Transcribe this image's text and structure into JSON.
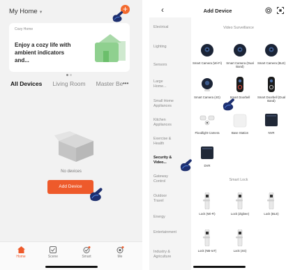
{
  "left": {
    "home_title": "My Home",
    "banner": {
      "tag": "Cozy Home",
      "text": "Enjoy a cozy life with ambient indicators and..."
    },
    "tabs": [
      "All Devices",
      "Living Room",
      "Master Be"
    ],
    "empty_text": "No devices",
    "add_device_label": "Add Device",
    "nav": [
      {
        "label": "Home",
        "icon": "home-icon",
        "active": true
      },
      {
        "label": "Scene",
        "icon": "scene-icon",
        "active": false
      },
      {
        "label": "Smart",
        "icon": "smart-icon",
        "active": false
      },
      {
        "label": "Me",
        "icon": "profile-icon",
        "active": false
      }
    ],
    "accent_color": "#ee5a2b"
  },
  "right": {
    "title": "Add Device",
    "categories": [
      {
        "label": "Electrical",
        "active": false
      },
      {
        "label": "Lighting",
        "active": false
      },
      {
        "label": "Sensors",
        "active": false
      },
      {
        "label": "Large Home...",
        "active": false
      },
      {
        "label": "Small Home Appliances",
        "active": false
      },
      {
        "label": "Kitchen Appliances",
        "active": false
      },
      {
        "label": "Exercise & Health",
        "active": false
      },
      {
        "label": "Security & Video...",
        "active": true
      },
      {
        "label": "Gateway Control",
        "active": false
      },
      {
        "label": "Outdoor Travel",
        "active": false
      },
      {
        "label": "Energy",
        "active": false
      },
      {
        "label": "Entertainment",
        "active": false
      },
      {
        "label": "Industry & Agriculture",
        "active": false
      }
    ],
    "sections": {
      "video_surveillance": "Video Surveillance",
      "smart_lock": "Smart Lock"
    },
    "devices": {
      "cam_wifi": "Smart Camera (Wi-Fi)",
      "cam_dual": "Smart Camera (Dual Band)",
      "cam_ble": "Smart Camera (BLE)",
      "cam_4g": "Smart Camera (4G)",
      "doorbell": "Smart Doorbell",
      "doorbell_dual": "Smart Doorbell (Dual Band)",
      "floodlight": "Floodlight Camera",
      "base_station": "Base Station",
      "nvr": "NVR",
      "dvr": "DVR",
      "lock_wifi": "Lock (Wi-Fi)",
      "lock_zigbee": "Lock (Zigbee)",
      "lock_ble": "Lock (BLE)",
      "lock_nbiot": "Lock (NB-IoT)",
      "lock_4g": "Lock (4G)"
    }
  }
}
